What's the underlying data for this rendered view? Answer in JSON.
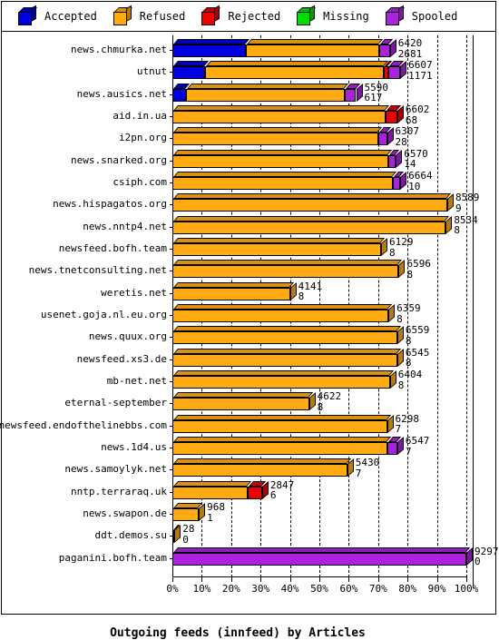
{
  "legend": {
    "items": [
      {
        "label": "Accepted",
        "color": "#0000dd",
        "icon": "cube-icon"
      },
      {
        "label": "Refused",
        "color": "#ffaa11",
        "icon": "cube-icon"
      },
      {
        "label": "Rejected",
        "color": "#ee0000",
        "icon": "cube-icon"
      },
      {
        "label": "Missing",
        "color": "#00dd00",
        "icon": "cube-icon"
      },
      {
        "label": "Spooled",
        "color": "#aa22dd",
        "icon": "cube-icon"
      }
    ]
  },
  "chart_data": {
    "type": "bar",
    "title": "Outgoing feeds (innfeed) by Articles",
    "xlabel": "Outgoing feeds (innfeed) by Articles",
    "ylabel": "",
    "orientation": "horizontal",
    "stacked": true,
    "normalized_percent": true,
    "grid": true,
    "legend_position": "top",
    "xlim": [
      0,
      100
    ],
    "xticks": [
      "0%",
      "10%",
      "20%",
      "30%",
      "40%",
      "50%",
      "60%",
      "70%",
      "80%",
      "90%",
      "100%"
    ],
    "series": [
      {
        "name": "Accepted",
        "color": "#0000dd"
      },
      {
        "name": "Refused",
        "color": "#ffaa11"
      },
      {
        "name": "Rejected",
        "color": "#ee0000"
      },
      {
        "name": "Missing",
        "color": "#00dd00"
      },
      {
        "name": "Spooled",
        "color": "#aa22dd"
      }
    ],
    "categories": [
      "news.chmurka.net",
      "utnut",
      "news.ausics.net",
      "aid.in.ua",
      "i2pn.org",
      "news.snarked.org",
      "csiph.com",
      "news.hispagatos.org",
      "news.nntp4.net",
      "newsfeed.bofh.team",
      "news.tnetconsulting.net",
      "weretis.net",
      "usenet.goja.nl.eu.org",
      "news.quux.org",
      "newsfeed.xs3.de",
      "mb-net.net",
      "eternal-september",
      "newsfeed.endofthelinebbs.com",
      "news.1d4.us",
      "news.samoylyk.net",
      "nntp.terraraq.uk",
      "news.swapon.de",
      "ddt.demos.su",
      "paganini.bofh.team"
    ],
    "rows": [
      {
        "label": "news.chmurka.net",
        "total": 6420,
        "second": 2681,
        "pct": 74.0,
        "segments": [
          {
            "s": "Accepted",
            "pct": 25.0
          },
          {
            "s": "Refused",
            "pct": 45.5
          },
          {
            "s": "Spooled",
            "pct": 3.5
          }
        ]
      },
      {
        "label": "utnut",
        "total": 6607,
        "second": 1171,
        "pct": 77.5,
        "segments": [
          {
            "s": "Accepted",
            "pct": 11.0
          },
          {
            "s": "Refused",
            "pct": 61.0
          },
          {
            "s": "Rejected",
            "pct": 1.5
          },
          {
            "s": "Spooled",
            "pct": 4.0
          }
        ]
      },
      {
        "label": "news.ausics.net",
        "total": 5590,
        "second": 617,
        "pct": 62.5,
        "segments": [
          {
            "s": "Accepted",
            "pct": 4.5
          },
          {
            "s": "Refused",
            "pct": 54.0
          },
          {
            "s": "Spooled",
            "pct": 4.0
          }
        ]
      },
      {
        "label": "aid.in.ua",
        "total": 6602,
        "second": 68,
        "pct": 76.5,
        "segments": [
          {
            "s": "Refused",
            "pct": 72.5
          },
          {
            "s": "Rejected",
            "pct": 4.0
          }
        ]
      },
      {
        "label": "i2pn.org",
        "total": 6307,
        "second": 28,
        "pct": 73.0,
        "segments": [
          {
            "s": "Refused",
            "pct": 70.0
          },
          {
            "s": "Spooled",
            "pct": 3.0
          }
        ]
      },
      {
        "label": "news.snarked.org",
        "total": 6570,
        "second": 14,
        "pct": 76.0,
        "segments": [
          {
            "s": "Refused",
            "pct": 73.5
          },
          {
            "s": "Spooled",
            "pct": 2.5
          }
        ]
      },
      {
        "label": "csiph.com",
        "total": 6664,
        "second": 10,
        "pct": 77.5,
        "segments": [
          {
            "s": "Refused",
            "pct": 75.0
          },
          {
            "s": "Spooled",
            "pct": 2.5
          }
        ]
      },
      {
        "label": "news.hispagatos.org",
        "total": 8589,
        "second": 9,
        "pct": 93.5,
        "segments": [
          {
            "s": "Refused",
            "pct": 93.5
          }
        ]
      },
      {
        "label": "news.nntp4.net",
        "total": 8534,
        "second": 8,
        "pct": 93.0,
        "segments": [
          {
            "s": "Refused",
            "pct": 93.0
          }
        ]
      },
      {
        "label": "newsfeed.bofh.team",
        "total": 6129,
        "second": 8,
        "pct": 71.0,
        "segments": [
          {
            "s": "Refused",
            "pct": 71.0
          }
        ]
      },
      {
        "label": "news.tnetconsulting.net",
        "total": 6596,
        "second": 8,
        "pct": 77.0,
        "segments": [
          {
            "s": "Refused",
            "pct": 77.0
          }
        ]
      },
      {
        "label": "weretis.net",
        "total": 4141,
        "second": 8,
        "pct": 40.0,
        "segments": [
          {
            "s": "Refused",
            "pct": 40.0
          }
        ]
      },
      {
        "label": "usenet.goja.nl.eu.org",
        "total": 6359,
        "second": 8,
        "pct": 73.5,
        "segments": [
          {
            "s": "Refused",
            "pct": 73.5
          }
        ]
      },
      {
        "label": "news.quux.org",
        "total": 6559,
        "second": 8,
        "pct": 76.5,
        "segments": [
          {
            "s": "Refused",
            "pct": 76.5
          }
        ]
      },
      {
        "label": "newsfeed.xs3.de",
        "total": 6545,
        "second": 8,
        "pct": 76.5,
        "segments": [
          {
            "s": "Refused",
            "pct": 76.5
          }
        ]
      },
      {
        "label": "mb-net.net",
        "total": 6404,
        "second": 8,
        "pct": 74.0,
        "segments": [
          {
            "s": "Refused",
            "pct": 74.0
          }
        ]
      },
      {
        "label": "eternal-september",
        "total": 4622,
        "second": 8,
        "pct": 46.5,
        "segments": [
          {
            "s": "Refused",
            "pct": 46.5
          }
        ]
      },
      {
        "label": "newsfeed.endofthelinebbs.com",
        "total": 6298,
        "second": 7,
        "pct": 73.0,
        "segments": [
          {
            "s": "Refused",
            "pct": 73.0
          }
        ]
      },
      {
        "label": "news.1d4.us",
        "total": 6547,
        "second": 7,
        "pct": 76.5,
        "segments": [
          {
            "s": "Refused",
            "pct": 73.0
          },
          {
            "s": "Spooled",
            "pct": 3.5
          }
        ]
      },
      {
        "label": "news.samoylyk.net",
        "total": 5430,
        "second": 7,
        "pct": 59.5,
        "segments": [
          {
            "s": "Refused",
            "pct": 59.5
          }
        ]
      },
      {
        "label": "nntp.terraraq.uk",
        "total": 2847,
        "second": 6,
        "pct": 30.5,
        "segments": [
          {
            "s": "Refused",
            "pct": 25.5
          },
          {
            "s": "Rejected",
            "pct": 5.0
          }
        ]
      },
      {
        "label": "news.swapon.de",
        "total": 968,
        "second": 1,
        "pct": 9.0,
        "segments": [
          {
            "s": "Refused",
            "pct": 9.0
          }
        ]
      },
      {
        "label": "ddt.demos.su",
        "total": 28,
        "second": 0,
        "pct": 0.7,
        "segments": [
          {
            "s": "Refused",
            "pct": 0.7
          }
        ]
      },
      {
        "label": "paganini.bofh.team",
        "total": 9297,
        "second": 0,
        "pct": 100.0,
        "segments": [
          {
            "s": "Spooled",
            "pct": 100.0
          }
        ]
      }
    ]
  }
}
